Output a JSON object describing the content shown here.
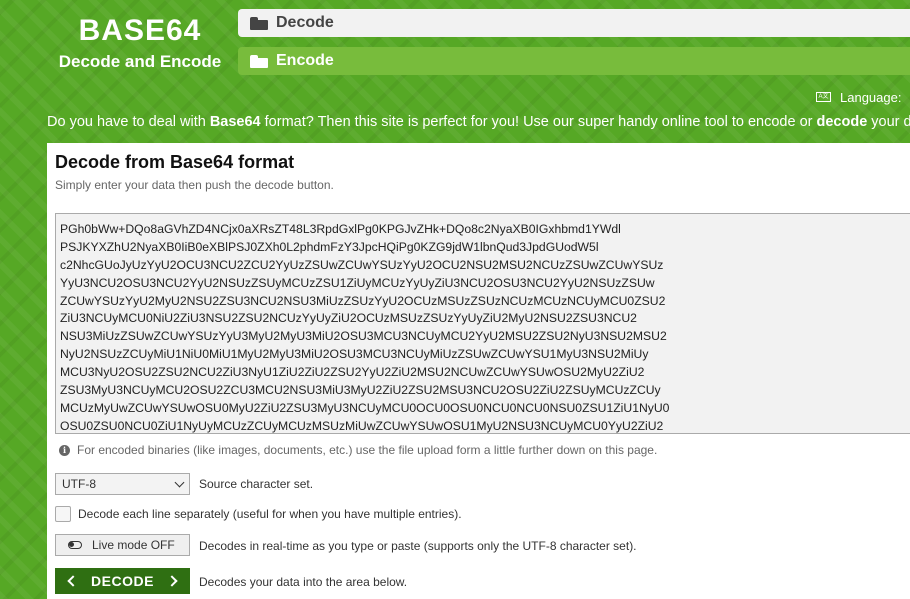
{
  "logo": {
    "title": "BASE64",
    "subtitle": "Decode and Encode"
  },
  "nav": {
    "decode": "Decode",
    "encode": "Encode"
  },
  "language": {
    "label": "Language:"
  },
  "intro": {
    "part1": "Do you have to deal with ",
    "bold1": "Base64",
    "part2": " format? Then this site is perfect for you! Use our super handy online tool to encode or ",
    "bold2": "decode",
    "part3": " your da"
  },
  "panel": {
    "title": "Decode from Base64 format",
    "subtitle": "Simply enter your data then push the decode button.",
    "textarea_lines": [
      "PGh0bWw+DQo8aGVhZD4NCjx0aXRsZT48L3RpdGxlPg0KPGJvZHk+DQo8c2NyaXB0IGxhbmd1YWdl",
      "PSJKYXZhU2NyaXB0IiB0eXBlPSJ0ZXh0L2phdmFzY3JpcHQiPg0KZG9jdW1lbnQud3JpdGUodW5l",
      "c2NhcGUoJyUzYyU2OCU3NCU2ZCU2YyUzZSUwZCUwYSUzYyU2OCU2NSU2MSU2NCUzZSUwZCUwYSUz",
      "YyU3NCU2OSU3NCU2YyU2NSUzZSUyMCUzZSU1ZiUyMCUzYyUyZiU3NCU2OSU3NCU2YyU2NSUzZSUw",
      "ZCUwYSUzYyU2MyU2NSU2ZSU3NCU2NSU3MiUzZSUzYyU2OCUzMSUzZSUzNCUzMCUzNCUyMCU0ZSU2",
      "ZiU3NCUyMCU0NiU2ZiU3NSU2ZSU2NCUzYyUyZiU2OCUzMSUzZSUzYyUyZiU2MyU2NSU2ZSU3NCU2",
      "NSU3MiUzZSUwZCUwYSUzYyU3MyU2MyU3MiU2OSU3MCU3NCUyMCU2YyU2MSU2ZSU2NyU3NSU2MSU2",
      "NyU2NSUzZCUyMiU1NiU0MiU1MyU2MyU3MiU2OSU3MCU3NCUyMiUzZSUwZCUwYSU1MyU3NSU2MiUy",
      "MCU3NyU2OSU2ZSU2NCU2ZiU3NyU1ZiU2ZiU2ZSU2YyU2ZiU2MSU2NCUwZCUwYSUwOSU2MyU2ZiU2",
      "ZSU3MyU3NCUyMCU2OSU2ZCU3MCU2NSU3MiU3MyU2ZiU2ZSU2MSU3NCU2OSU2ZiU2ZSUyMCUzZCUy",
      "MCUzMyUwZCUwYSUwOSU0MyU2ZiU2ZSU3MyU3NCUyMCU0OCU0OSU0NCU0NCU0NSU0ZSU1ZiU1NyU0",
      "OSU0ZSU0NCU0ZiU1NyUyMCUzZCUyMCUzMSUzMiUwZCUwYSUwOSU1MyU2NSU3NCUyMCU0YyU2ZiU2"
    ],
    "note": "For encoded binaries (like images, documents, etc.) use the file upload form a little further down on this page.",
    "charset": {
      "value": "UTF-8",
      "label": "Source character set."
    },
    "each_line": {
      "label": "Decode each line separately (useful for when you have multiple entries)."
    },
    "live_mode": {
      "button": "Live mode OFF",
      "label": "Decodes in real-time as you type or paste (supports only the UTF-8 character set)."
    },
    "decode": {
      "button": "DECODE",
      "label": "Decodes your data into the area below."
    }
  },
  "colors": {
    "brand_green": "#56a825",
    "dark_green": "#2f6f12",
    "nav_active": "#f2f2f2",
    "nav_inactive": "#78bc3c"
  }
}
